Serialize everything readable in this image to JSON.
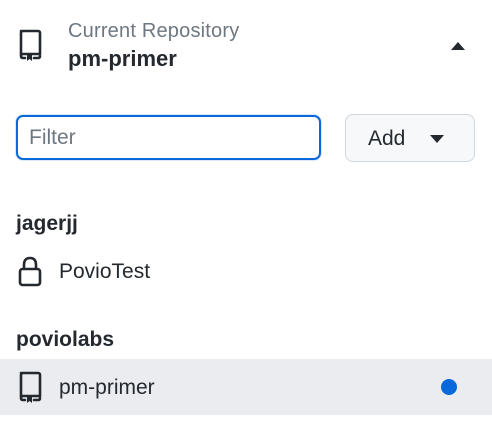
{
  "header": {
    "caption": "Current Repository",
    "title": "pm-primer",
    "icon": "repo-icon",
    "toggle_icon": "caret-up-icon"
  },
  "filter": {
    "value": "",
    "placeholder": "Filter"
  },
  "add_button": {
    "label": "Add",
    "icon": "caret-down-icon"
  },
  "groups": [
    {
      "name": "jagerjj",
      "items": [
        {
          "label": "PovioTest",
          "icon": "lock-icon",
          "selected": false,
          "changes": false
        }
      ]
    },
    {
      "name": "poviolabs",
      "items": [
        {
          "label": "pm-primer",
          "icon": "repo-icon",
          "selected": true,
          "changes": true
        }
      ]
    }
  ],
  "colors": {
    "accent": "#0969da",
    "dot": "#0969da",
    "selected_bg": "#eaecef"
  }
}
